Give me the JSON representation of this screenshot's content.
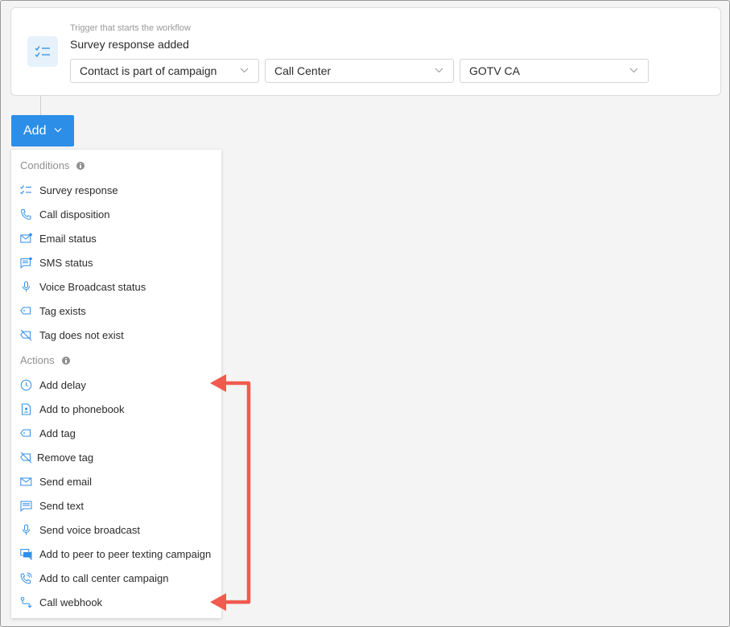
{
  "trigger": {
    "caption": "Trigger that starts the workflow",
    "title": "Survey response added",
    "icon": "checklist-icon",
    "filters": [
      {
        "value": "Contact is part of campaign"
      },
      {
        "value": "Call Center"
      },
      {
        "value": "GOTV CA"
      }
    ]
  },
  "add_button": {
    "label": "Add"
  },
  "menu": {
    "conditions_header": "Conditions",
    "conditions": [
      {
        "label": "Survey response",
        "icon": "checklist-icon"
      },
      {
        "label": "Call disposition",
        "icon": "phone-icon"
      },
      {
        "label": "Email status",
        "icon": "mail-status-icon"
      },
      {
        "label": "SMS status",
        "icon": "sms-status-icon"
      },
      {
        "label": "Voice Broadcast status",
        "icon": "microphone-icon"
      },
      {
        "label": "Tag exists",
        "icon": "tag-icon"
      },
      {
        "label": "Tag does not exist",
        "icon": "tag-off-icon"
      }
    ],
    "actions_header": "Actions",
    "actions": [
      {
        "label": "Add delay",
        "icon": "clock-icon"
      },
      {
        "label": "Add to phonebook",
        "icon": "phonebook-icon"
      },
      {
        "label": "Add tag",
        "icon": "tag-icon"
      },
      {
        "label": "Remove tag",
        "icon": "tag-off-icon"
      },
      {
        "label": "Send email",
        "icon": "mail-icon"
      },
      {
        "label": "Send text",
        "icon": "message-icon"
      },
      {
        "label": "Send voice broadcast",
        "icon": "microphone-icon"
      },
      {
        "label": "Add to peer to peer texting campaign",
        "icon": "chat-icon"
      },
      {
        "label": "Add to call center campaign",
        "icon": "phone-call-icon"
      },
      {
        "label": "Call webhook",
        "icon": "webhook-icon"
      }
    ]
  },
  "colors": {
    "accent": "#2d8ee8",
    "annotation": "#f05a4f"
  }
}
